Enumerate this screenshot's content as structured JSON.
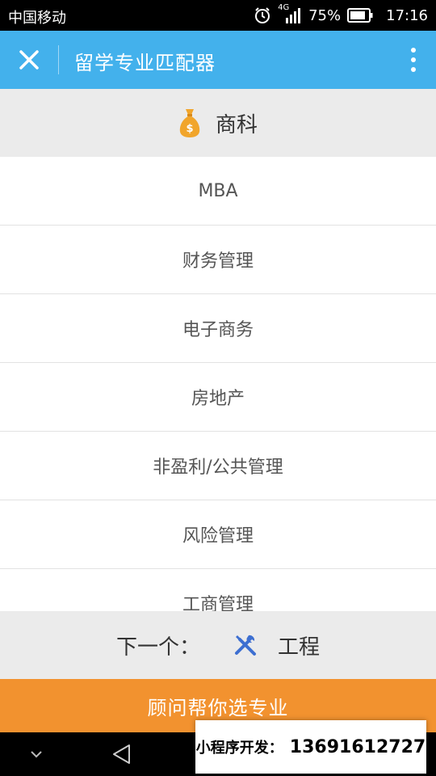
{
  "statusbar": {
    "carrier": "中国移动",
    "network": "4G",
    "battery": "75%",
    "time": "17:16"
  },
  "titlebar": {
    "title": "留学专业匹配器",
    "close_icon": "close-icon",
    "more_icon": "more-vertical-icon"
  },
  "category": {
    "icon": "money-bag-icon",
    "label": "商科"
  },
  "majors": [
    "MBA",
    "财务管理",
    "电子商务",
    "房地产",
    "非盈利/公共管理",
    "风险管理",
    "工商管理"
  ],
  "next": {
    "label": "下一个：",
    "icon": "tools-icon",
    "category": "工程"
  },
  "consult_button": "顾问帮你选专业",
  "overlay": {
    "label": "小程序开发：",
    "phone": "13691612727"
  },
  "colors": {
    "titlebar": "#43b1ec",
    "consult": "#f2922f",
    "header_bg": "#ebebeb",
    "money_bag": "#f1a52b",
    "tools": "#3d6fd1"
  }
}
